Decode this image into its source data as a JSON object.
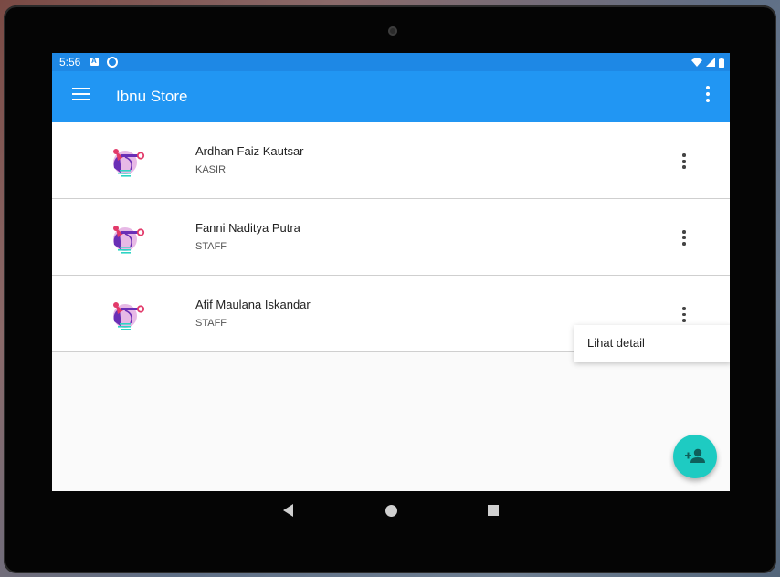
{
  "status_bar": {
    "time": "5:56",
    "left_icons": [
      "a-notification-icon",
      "sync-circle-icon"
    ],
    "right_icons": [
      "wifi-icon",
      "signal-icon",
      "battery-icon"
    ]
  },
  "app_bar": {
    "title": "Ibnu Store",
    "menu_icon": "hamburger-menu-icon",
    "overflow_icon": "more-vert-icon",
    "color": "#2196f3"
  },
  "users": [
    {
      "name": "Ardhan Faiz Kautsar",
      "role": "KASIR"
    },
    {
      "name": "Fanni Naditya Putra",
      "role": "STAFF"
    },
    {
      "name": "Afif Maulana Iskandar",
      "role": "STAFF"
    }
  ],
  "popup_menu": {
    "items": [
      "Lihat detail"
    ]
  },
  "fab": {
    "icon": "person-add-icon",
    "color": "#1ecbc2"
  },
  "nav_bar": {
    "icons": [
      "back-icon",
      "home-icon",
      "recent-apps-icon"
    ]
  }
}
